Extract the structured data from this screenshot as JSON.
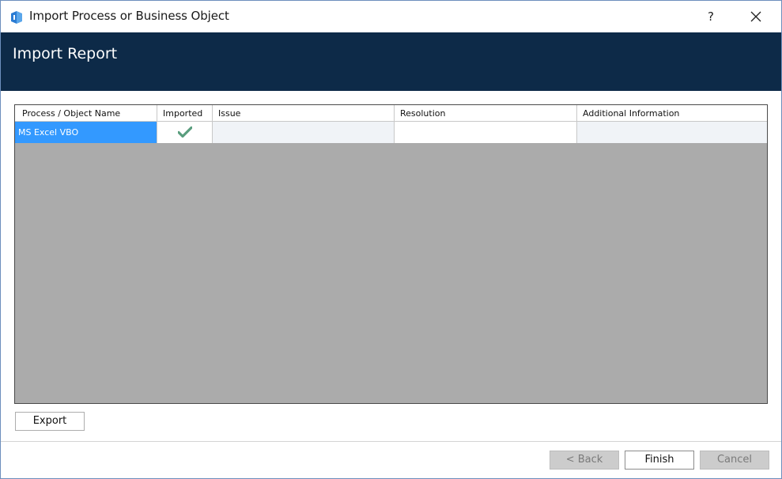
{
  "window": {
    "title": "Import Process or Business Object",
    "help_label": "?",
    "app_icon": "app-logo-icon",
    "close_icon": "close-icon"
  },
  "banner": {
    "title": "Import Report"
  },
  "grid": {
    "columns": [
      "Process / Object Name",
      "Imported",
      "Issue",
      "Resolution",
      "Additional Information"
    ],
    "rows": [
      {
        "name": "MS Excel VBO",
        "imported": "check-icon",
        "issue": "",
        "resolution": "",
        "additional_information": ""
      }
    ]
  },
  "buttons": {
    "export": "Export",
    "back": "< Back",
    "finish": "Finish",
    "cancel": "Cancel"
  },
  "colors": {
    "banner": "#0d2a48",
    "selection": "#3399ff",
    "grid_background": "#ababab",
    "check": "#5a9e7e"
  }
}
